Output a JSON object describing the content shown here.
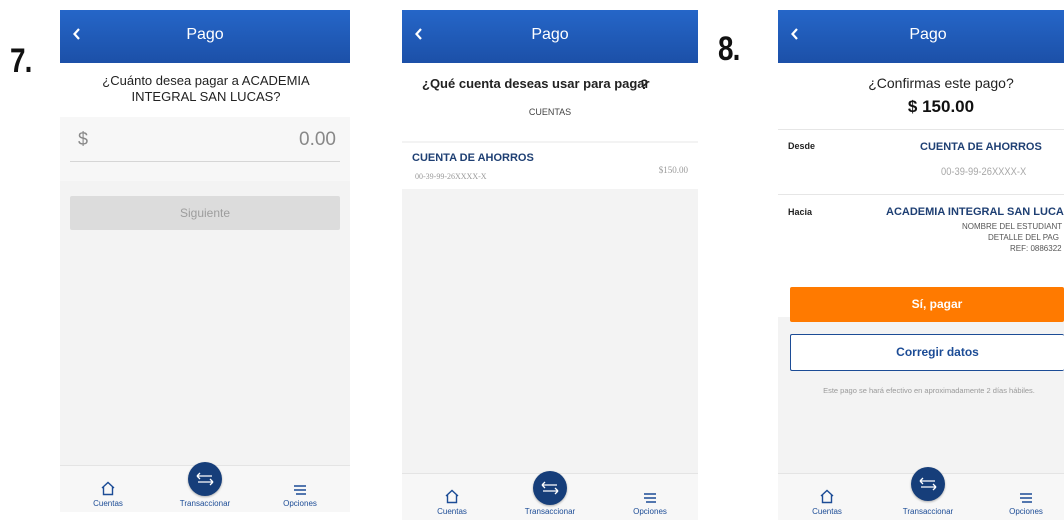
{
  "steps": {
    "seven": "7.",
    "eight": "8."
  },
  "screen1": {
    "header_title": "Pago",
    "question": "¿Cuánto desea pagar a ACADEMIA INTEGRAL SAN LUCAS?",
    "currency_symbol": "$",
    "amount_placeholder": "0.00",
    "next_button": "Siguiente"
  },
  "screen2": {
    "header_title": "Pago",
    "question": "¿Qué cuenta deseas usar para pagar",
    "question_mark": "?",
    "section_label": "CUENTAS",
    "account_name": "CUENTA DE AHORROS",
    "account_number": "00-39-99-26XXXX-X",
    "account_amount": "$150.00"
  },
  "screen3": {
    "header_title": "Pago",
    "confirm_question": "¿Confirmas este pago?",
    "confirm_amount": "$ 150.00",
    "from_label": "Desde",
    "from_account": "CUENTA DE AHORROS",
    "from_number": "00-39-99-26XXXX-X",
    "to_label": "Hacia",
    "to_name": "ACADEMIA INTEGRAL SAN LUCAS",
    "to_student": "NOMBRE DEL ESTUDIANT",
    "to_detail": "DETALLE DEL PAG",
    "to_ref": "REF: 0886322",
    "pay_button": "Sí, pagar",
    "edit_button": "Corregir datos",
    "notice": "Este pago se hará efectivo en aproximadamente 2 días hábiles."
  },
  "nav": {
    "accounts": "Cuentas",
    "transact": "Transaccionar",
    "options": "Opciones"
  },
  "colors": {
    "header_blue": "#1f5bb8",
    "fab_blue": "#163e7a",
    "pay_orange": "#ff7a00",
    "outline_blue": "#1c4c96"
  },
  "icons": {
    "back": "chevron-left-icon",
    "home": "home-icon",
    "transfer": "transfer-arrows-icon",
    "menu": "menu-lines-icon"
  }
}
